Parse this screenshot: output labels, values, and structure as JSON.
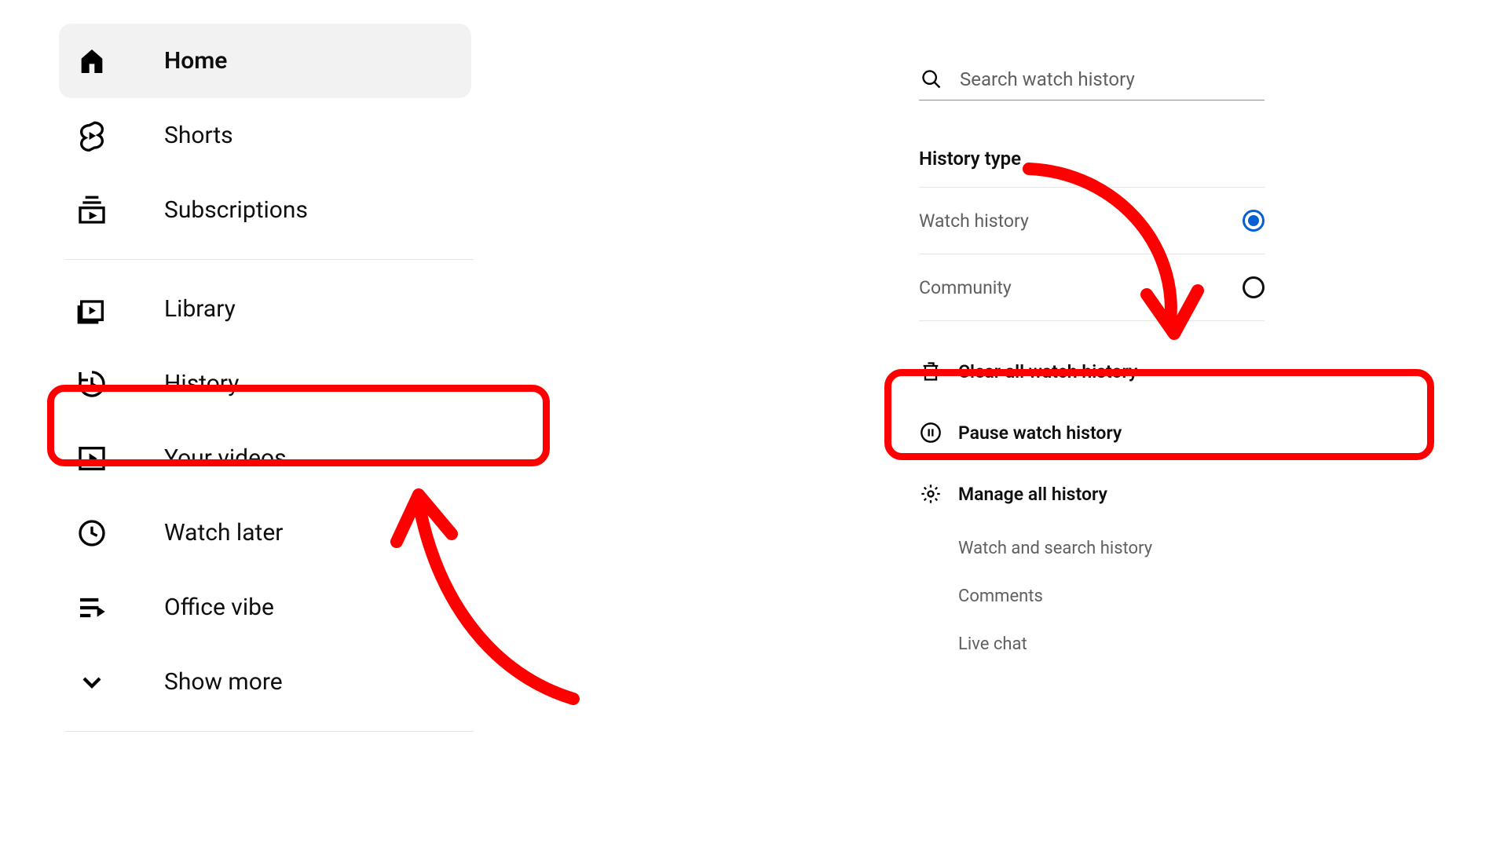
{
  "sidebar": {
    "section1": [
      {
        "label": "Home",
        "icon": "home",
        "active": true
      },
      {
        "label": "Shorts",
        "icon": "shorts",
        "active": false
      },
      {
        "label": "Subscriptions",
        "icon": "subscriptions",
        "active": false
      }
    ],
    "section2": [
      {
        "label": "Library",
        "icon": "library"
      },
      {
        "label": "History",
        "icon": "history"
      },
      {
        "label": "Your videos",
        "icon": "your-videos"
      },
      {
        "label": "Watch later",
        "icon": "watch-later"
      },
      {
        "label": "Office vibe",
        "icon": "playlist"
      },
      {
        "label": "Show more",
        "icon": "chevron-down"
      }
    ]
  },
  "search": {
    "placeholder": "Search watch history"
  },
  "section_title": "History type",
  "history_types": [
    {
      "label": "Watch history",
      "selected": true
    },
    {
      "label": "Community",
      "selected": false
    }
  ],
  "actions": [
    {
      "label": "Clear all watch history",
      "icon": "trash"
    },
    {
      "label": "Pause watch history",
      "icon": "pause-circle"
    },
    {
      "label": "Manage all history",
      "icon": "gear"
    }
  ],
  "sub_links": [
    "Watch and search history",
    "Comments",
    "Live chat"
  ]
}
